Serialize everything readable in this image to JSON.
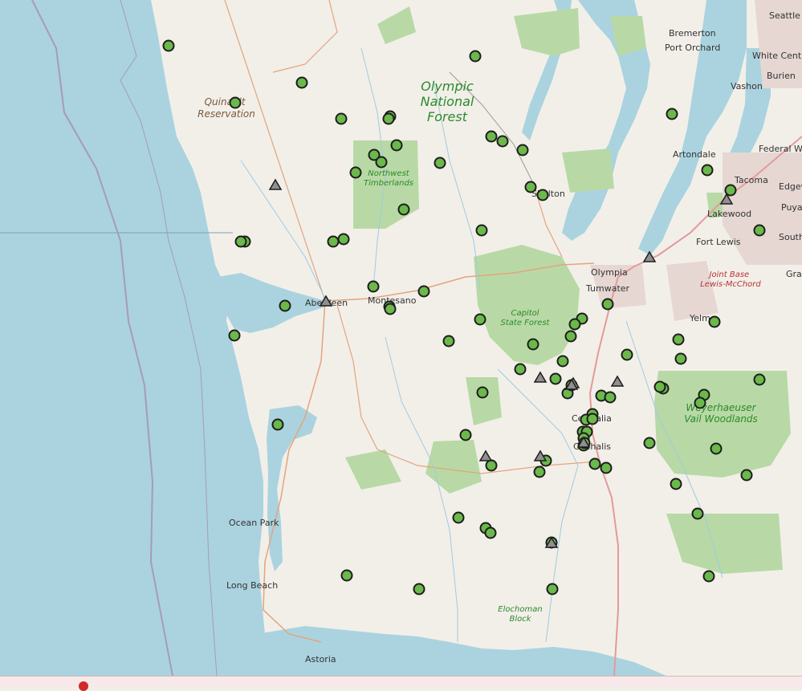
{
  "labels": {
    "cities": [
      {
        "id": "seattle",
        "text": "Seattle"
      },
      {
        "id": "bremerton",
        "text": "Bremerton"
      },
      {
        "id": "port-orchard",
        "text": "Port Orchard"
      },
      {
        "id": "white-center",
        "text": "White Center"
      },
      {
        "id": "burien",
        "text": "Burien"
      },
      {
        "id": "vashon",
        "text": "Vashon"
      },
      {
        "id": "artondale",
        "text": "Artondale"
      },
      {
        "id": "federal-way",
        "text": "Federal Wa"
      },
      {
        "id": "tacoma",
        "text": "Tacoma"
      },
      {
        "id": "edgewood",
        "text": "Edgew"
      },
      {
        "id": "puyallup",
        "text": "Puyal"
      },
      {
        "id": "lakewood",
        "text": "Lakewood"
      },
      {
        "id": "south-hill",
        "text": "South"
      },
      {
        "id": "fort-lewis",
        "text": "Fort Lewis"
      },
      {
        "id": "graham",
        "text": "Gral"
      },
      {
        "id": "olympia",
        "text": "Olympia"
      },
      {
        "id": "tumwater",
        "text": "Tumwater"
      },
      {
        "id": "yelm",
        "text": "Yelm"
      },
      {
        "id": "aberdeen",
        "text": "Aberdeen"
      },
      {
        "id": "montesano",
        "text": "Montesano"
      },
      {
        "id": "shelton",
        "text": "Shelton"
      },
      {
        "id": "centralia",
        "text": "Centralia"
      },
      {
        "id": "chehalis",
        "text": "Chehalis"
      },
      {
        "id": "ocean-park",
        "text": "Ocean Park"
      },
      {
        "id": "long-beach",
        "text": "Long Beach"
      },
      {
        "id": "astoria",
        "text": "Astoria"
      }
    ],
    "forests": [
      {
        "id": "olympic-nf",
        "lines": [
          "Olympic",
          "National",
          "Forest"
        ]
      },
      {
        "id": "northwest-timberlands",
        "lines": [
          "Northwest",
          "Timberlands"
        ]
      },
      {
        "id": "capitol-sf",
        "lines": [
          "Capitol",
          "State Forest"
        ]
      },
      {
        "id": "weyerhaeuser",
        "lines": [
          "Weyerhaeuser",
          "Vail Woodlands"
        ]
      },
      {
        "id": "elochoman",
        "lines": [
          "Elochoman",
          "Block"
        ]
      }
    ],
    "reservation": {
      "lines": [
        "Quinault",
        "Reservation"
      ]
    },
    "military": {
      "lines": [
        "Joint Base",
        "Lewis-McChord"
      ]
    }
  },
  "markers": {
    "site_color": "#6bb84b",
    "triangle_color": "#8f8f8f",
    "site_icon": "green-circle-marker",
    "triangle_icon": "gray-triangle-marker",
    "site_count": 85,
    "triangle_count": 12
  }
}
